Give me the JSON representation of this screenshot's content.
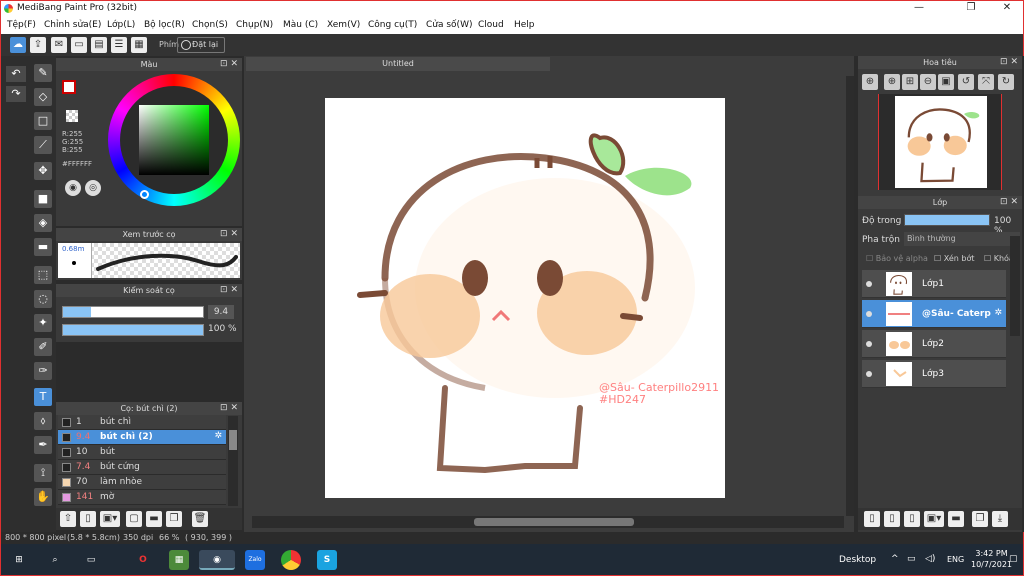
{
  "app": {
    "title": "MediBang Paint Pro (32bit)"
  },
  "menu": [
    "Tệp(F)",
    "Chỉnh sửa(E)",
    "Lớp(L)",
    "Bộ lọc(R)",
    "Chọn(S)",
    "Chụp(N)",
    "Màu (C)",
    "Xem(V)",
    "Công cụ(T)",
    "Cửa số(W)",
    "Cloud",
    "Help"
  ],
  "toolbar": {
    "key_label": "Phím",
    "reset_label": "Đặt lại"
  },
  "color_panel": {
    "title": "Màu",
    "r": "R:255",
    "g": "G:255",
    "b": "B:255",
    "hex": "#FFFFFF"
  },
  "brush_preview": {
    "title": "Xem trước cọ",
    "size": "0.68m"
  },
  "brush_control": {
    "title": "Kiểm soát cọ",
    "size_value": "9.4",
    "opacity_value": "100 %",
    "size_fraction": 0.2,
    "opacity_fraction": 1.0
  },
  "brush_list": {
    "title": "Cọ: bút chì (2)",
    "items": [
      {
        "size": "1",
        "name": "bút chì",
        "color": "#222222",
        "selected": false
      },
      {
        "size": "9.4",
        "name": "bút chì (2)",
        "color": "#222222",
        "selected": true
      },
      {
        "size": "10",
        "name": "bút",
        "color": "#222222",
        "selected": false
      },
      {
        "size": "7.4",
        "name": "bút cứng",
        "color": "#222222",
        "selected": false
      },
      {
        "size": "70",
        "name": "làm nhòe",
        "color": "#f5d6b0",
        "selected": false
      },
      {
        "size": "141",
        "name": "mờ",
        "color": "#e49ae0",
        "selected": false
      }
    ]
  },
  "canvas": {
    "tab": "Untitled",
    "watermark_line1": "@Sâu- Caterpillo2911",
    "watermark_line2": "#HD247"
  },
  "navigator": {
    "title": "Hoa tiêu"
  },
  "layers": {
    "title": "Lớp",
    "opacity_label": "Độ trong",
    "opacity_value": "100 %",
    "blend_label": "Pha trộn",
    "blend_value": "Bình thường",
    "protect_alpha": "Bảo vệ alpha",
    "clip": "Xén bớt",
    "lock": "Khóa",
    "items": [
      {
        "name": "Lớp1",
        "selected": false
      },
      {
        "name": "@Sâu- Caterp",
        "selected": true
      },
      {
        "name": "Lớp2",
        "selected": false
      },
      {
        "name": "Lớp3",
        "selected": false
      }
    ]
  },
  "status": {
    "size": "800 * 800 pixel",
    "physical": "(5.8 * 5.8cm)",
    "dpi": "350 dpi",
    "zoom": "66 %",
    "coords": "( 930, 399 )"
  },
  "taskbar": {
    "desktop": "Desktop",
    "lang": "ENG",
    "time": "3:42 PM",
    "date": "10/7/2021"
  },
  "colors": {
    "accent": "#4a90d9",
    "panel": "#3a3a3a",
    "brown": "#7a4a35",
    "peach": "#f8c898",
    "leaf": "#9de38c"
  }
}
